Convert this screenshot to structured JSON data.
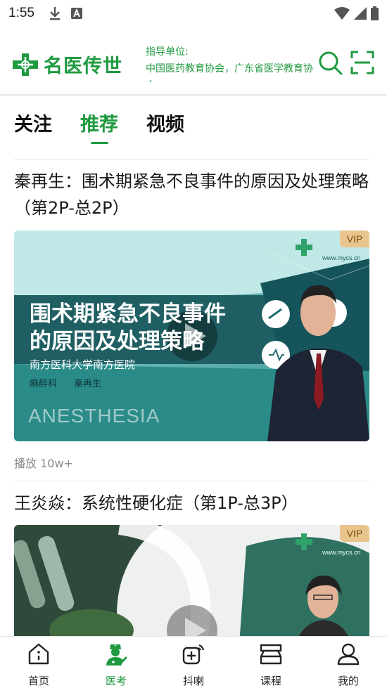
{
  "status_bar": {
    "time": "1:55"
  },
  "header": {
    "logo_text": "名医传世",
    "guide_label": "指导单位:",
    "guide_text": "中国医药教育协会，广东省医学教育协会"
  },
  "tabs": [
    {
      "label": "关注",
      "active": false
    },
    {
      "label": "推荐",
      "active": true
    },
    {
      "label": "视频",
      "active": false
    }
  ],
  "feed": [
    {
      "title": "秦再生：围术期紧急不良事件的原因及处理策略（第2P-总2P）",
      "badge": "VIP",
      "watermark": "www.mycs.cn",
      "thumb_title_line1": "围术期紧急不良事件",
      "thumb_title_line2": "的原因及处理策略",
      "thumb_hospital": "南方医科大学南方医院",
      "thumb_dept": "麻醉科",
      "thumb_doctor": "秦再生",
      "thumb_bg_word": "ANESTHESIA",
      "play_count": "播放 10w+"
    },
    {
      "title": "王炎焱：系统性硬化症（第1P-总3P）",
      "badge": "VIP",
      "watermark": "www.mycs.cn"
    }
  ],
  "bottom_nav": [
    {
      "label": "首页",
      "icon": "home-icon",
      "active": false
    },
    {
      "label": "医考",
      "icon": "doctor-exam-icon",
      "active": true
    },
    {
      "label": "抖喇",
      "icon": "video-post-icon",
      "active": false
    },
    {
      "label": "课程",
      "icon": "course-icon",
      "active": false
    },
    {
      "label": "我的",
      "icon": "profile-icon",
      "active": false
    }
  ],
  "colors": {
    "brand_green": "#1f9a3f",
    "vip_gold": "#e9c58e",
    "thumb_teal": "#1f6d6f"
  }
}
